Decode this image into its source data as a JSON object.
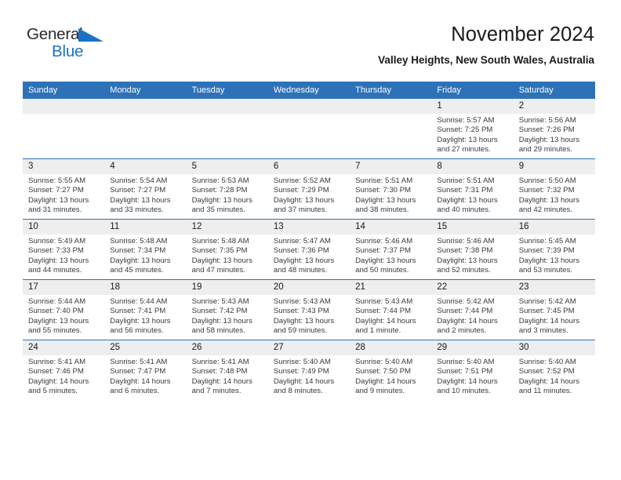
{
  "brand": {
    "name_part1": "General",
    "name_part2": "Blue",
    "triangle_color": "#1b72c4",
    "icon": "triangle-logo-icon"
  },
  "header": {
    "title": "November 2024",
    "subtitle": "Valley Heights, New South Wales, Australia"
  },
  "theme": {
    "header_blue": "#2d72b8",
    "daynum_gray": "#eeeeee",
    "text": "#3a3a3a"
  },
  "columns": [
    "Sunday",
    "Monday",
    "Tuesday",
    "Wednesday",
    "Thursday",
    "Friday",
    "Saturday"
  ],
  "weeks": [
    [
      {
        "empty": true
      },
      {
        "empty": true
      },
      {
        "empty": true
      },
      {
        "empty": true
      },
      {
        "empty": true
      },
      {
        "day": "1",
        "sunrise": "Sunrise: 5:57 AM",
        "sunset": "Sunset: 7:25 PM",
        "daylight": "Daylight: 13 hours and 27 minutes."
      },
      {
        "day": "2",
        "sunrise": "Sunrise: 5:56 AM",
        "sunset": "Sunset: 7:26 PM",
        "daylight": "Daylight: 13 hours and 29 minutes."
      }
    ],
    [
      {
        "day": "3",
        "sunrise": "Sunrise: 5:55 AM",
        "sunset": "Sunset: 7:27 PM",
        "daylight": "Daylight: 13 hours and 31 minutes."
      },
      {
        "day": "4",
        "sunrise": "Sunrise: 5:54 AM",
        "sunset": "Sunset: 7:27 PM",
        "daylight": "Daylight: 13 hours and 33 minutes."
      },
      {
        "day": "5",
        "sunrise": "Sunrise: 5:53 AM",
        "sunset": "Sunset: 7:28 PM",
        "daylight": "Daylight: 13 hours and 35 minutes."
      },
      {
        "day": "6",
        "sunrise": "Sunrise: 5:52 AM",
        "sunset": "Sunset: 7:29 PM",
        "daylight": "Daylight: 13 hours and 37 minutes."
      },
      {
        "day": "7",
        "sunrise": "Sunrise: 5:51 AM",
        "sunset": "Sunset: 7:30 PM",
        "daylight": "Daylight: 13 hours and 38 minutes."
      },
      {
        "day": "8",
        "sunrise": "Sunrise: 5:51 AM",
        "sunset": "Sunset: 7:31 PM",
        "daylight": "Daylight: 13 hours and 40 minutes."
      },
      {
        "day": "9",
        "sunrise": "Sunrise: 5:50 AM",
        "sunset": "Sunset: 7:32 PM",
        "daylight": "Daylight: 13 hours and 42 minutes."
      }
    ],
    [
      {
        "day": "10",
        "sunrise": "Sunrise: 5:49 AM",
        "sunset": "Sunset: 7:33 PM",
        "daylight": "Daylight: 13 hours and 44 minutes."
      },
      {
        "day": "11",
        "sunrise": "Sunrise: 5:48 AM",
        "sunset": "Sunset: 7:34 PM",
        "daylight": "Daylight: 13 hours and 45 minutes."
      },
      {
        "day": "12",
        "sunrise": "Sunrise: 5:48 AM",
        "sunset": "Sunset: 7:35 PM",
        "daylight": "Daylight: 13 hours and 47 minutes."
      },
      {
        "day": "13",
        "sunrise": "Sunrise: 5:47 AM",
        "sunset": "Sunset: 7:36 PM",
        "daylight": "Daylight: 13 hours and 48 minutes."
      },
      {
        "day": "14",
        "sunrise": "Sunrise: 5:46 AM",
        "sunset": "Sunset: 7:37 PM",
        "daylight": "Daylight: 13 hours and 50 minutes."
      },
      {
        "day": "15",
        "sunrise": "Sunrise: 5:46 AM",
        "sunset": "Sunset: 7:38 PM",
        "daylight": "Daylight: 13 hours and 52 minutes."
      },
      {
        "day": "16",
        "sunrise": "Sunrise: 5:45 AM",
        "sunset": "Sunset: 7:39 PM",
        "daylight": "Daylight: 13 hours and 53 minutes."
      }
    ],
    [
      {
        "day": "17",
        "sunrise": "Sunrise: 5:44 AM",
        "sunset": "Sunset: 7:40 PM",
        "daylight": "Daylight: 13 hours and 55 minutes."
      },
      {
        "day": "18",
        "sunrise": "Sunrise: 5:44 AM",
        "sunset": "Sunset: 7:41 PM",
        "daylight": "Daylight: 13 hours and 56 minutes."
      },
      {
        "day": "19",
        "sunrise": "Sunrise: 5:43 AM",
        "sunset": "Sunset: 7:42 PM",
        "daylight": "Daylight: 13 hours and 58 minutes."
      },
      {
        "day": "20",
        "sunrise": "Sunrise: 5:43 AM",
        "sunset": "Sunset: 7:43 PM",
        "daylight": "Daylight: 13 hours and 59 minutes."
      },
      {
        "day": "21",
        "sunrise": "Sunrise: 5:43 AM",
        "sunset": "Sunset: 7:44 PM",
        "daylight": "Daylight: 14 hours and 1 minute."
      },
      {
        "day": "22",
        "sunrise": "Sunrise: 5:42 AM",
        "sunset": "Sunset: 7:44 PM",
        "daylight": "Daylight: 14 hours and 2 minutes."
      },
      {
        "day": "23",
        "sunrise": "Sunrise: 5:42 AM",
        "sunset": "Sunset: 7:45 PM",
        "daylight": "Daylight: 14 hours and 3 minutes."
      }
    ],
    [
      {
        "day": "24",
        "sunrise": "Sunrise: 5:41 AM",
        "sunset": "Sunset: 7:46 PM",
        "daylight": "Daylight: 14 hours and 5 minutes."
      },
      {
        "day": "25",
        "sunrise": "Sunrise: 5:41 AM",
        "sunset": "Sunset: 7:47 PM",
        "daylight": "Daylight: 14 hours and 6 minutes."
      },
      {
        "day": "26",
        "sunrise": "Sunrise: 5:41 AM",
        "sunset": "Sunset: 7:48 PM",
        "daylight": "Daylight: 14 hours and 7 minutes."
      },
      {
        "day": "27",
        "sunrise": "Sunrise: 5:40 AM",
        "sunset": "Sunset: 7:49 PM",
        "daylight": "Daylight: 14 hours and 8 minutes."
      },
      {
        "day": "28",
        "sunrise": "Sunrise: 5:40 AM",
        "sunset": "Sunset: 7:50 PM",
        "daylight": "Daylight: 14 hours and 9 minutes."
      },
      {
        "day": "29",
        "sunrise": "Sunrise: 5:40 AM",
        "sunset": "Sunset: 7:51 PM",
        "daylight": "Daylight: 14 hours and 10 minutes."
      },
      {
        "day": "30",
        "sunrise": "Sunrise: 5:40 AM",
        "sunset": "Sunset: 7:52 PM",
        "daylight": "Daylight: 14 hours and 11 minutes."
      }
    ]
  ]
}
